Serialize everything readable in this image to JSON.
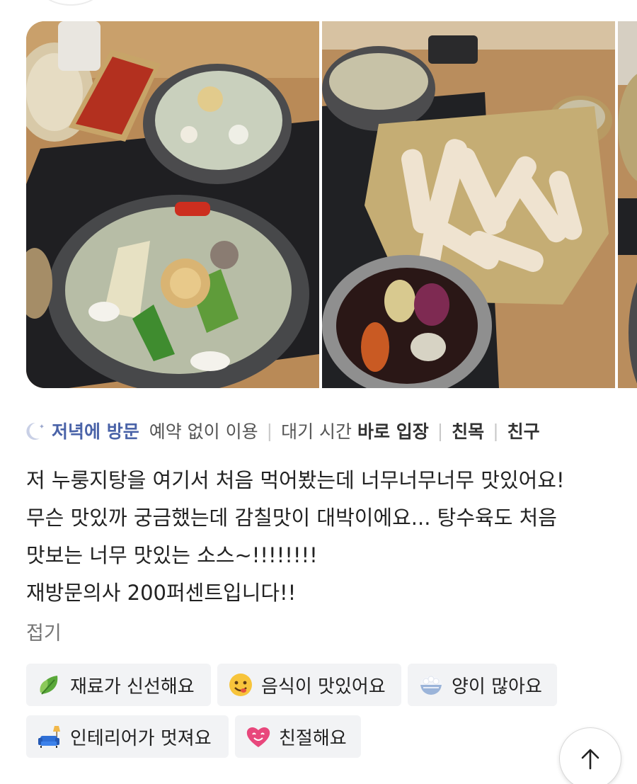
{
  "photos": [
    {
      "icon": "seafood-nurungji-tang-photo"
    },
    {
      "icon": "tangsuyuk-with-sauce-photo"
    },
    {
      "icon": "partial-next-photo"
    }
  ],
  "visit": {
    "time_label": "저녁에 방문",
    "reservation": "예약 없이 이용",
    "wait_label": "대기 시간",
    "wait_value": "바로 입장",
    "purpose": "친목",
    "companion": "친구"
  },
  "review": {
    "lines": [
      "저 누룽지탕을 여기서 처음 먹어봤는데 너무너무너무 맛있어요!",
      "무슨 맛있까 궁금했는데 감칠맛이 대박이에요... 탕수육도 처음",
      "맛보는 너무 맛있는 소스~!!!!!!!!",
      "재방문의사 200퍼센트입니다!!"
    ],
    "fold_label": "접기"
  },
  "keywords": [
    {
      "label": "재료가 신선해요",
      "icon": "leaf-icon"
    },
    {
      "label": "음식이 맛있어요",
      "icon": "yum-face-icon"
    },
    {
      "label": "양이 많아요",
      "icon": "rice-bowl-icon"
    },
    {
      "label": "인테리어가 멋져요",
      "icon": "sofa-lamp-icon"
    },
    {
      "label": "친절해요",
      "icon": "heart-face-icon"
    }
  ],
  "colors": {
    "accent": "#4a63a8",
    "chip_bg": "#f2f3f5",
    "fold": "#767676"
  }
}
